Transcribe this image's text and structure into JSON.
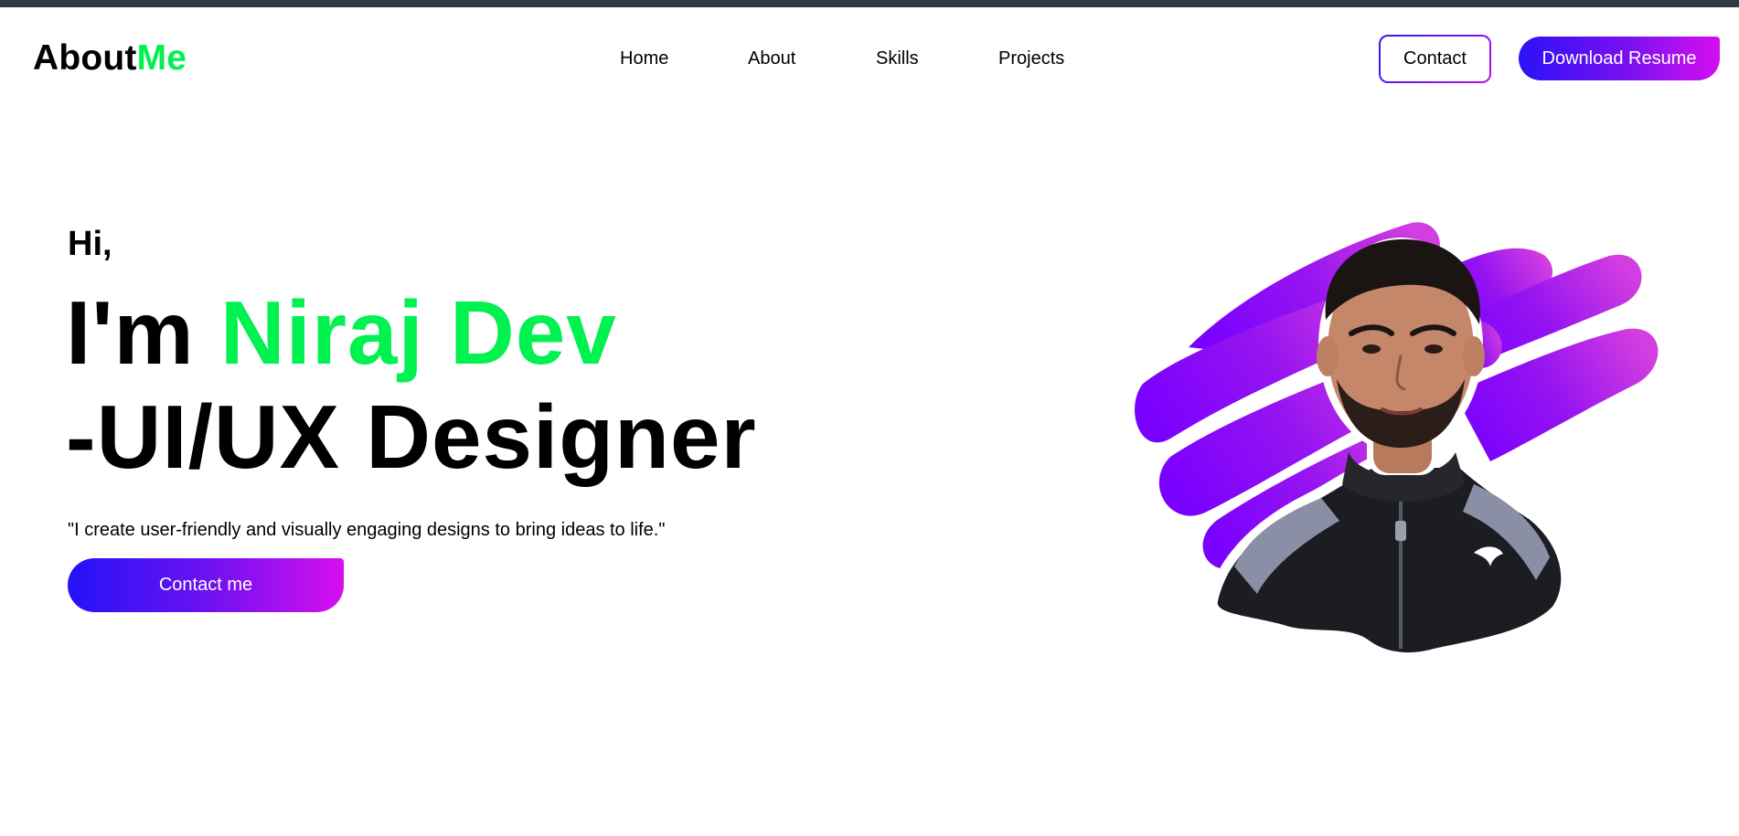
{
  "header": {
    "logo_main": "About",
    "logo_accent": "Me",
    "nav": [
      "Home",
      "About",
      "Skills",
      "Projects"
    ],
    "contact_label": "Contact",
    "resume_label": "Download Resume"
  },
  "hero": {
    "greeting": "Hi,",
    "intro_prefix": "I'm ",
    "name": "Niraj Dev",
    "role": "-UI/UX Designer",
    "tagline": "\"I create user-friendly and visually engaging designs to bring ideas to life.\"",
    "cta_label": "Contact me"
  },
  "icons": {
    "portrait": "profile-photo-icon",
    "brand": "puma-logo-icon"
  },
  "colors": {
    "accent_green": "#00f150",
    "gradient_start": "#2a12f7",
    "gradient_end": "#d40ff0",
    "top_strip": "#2f3a45"
  }
}
